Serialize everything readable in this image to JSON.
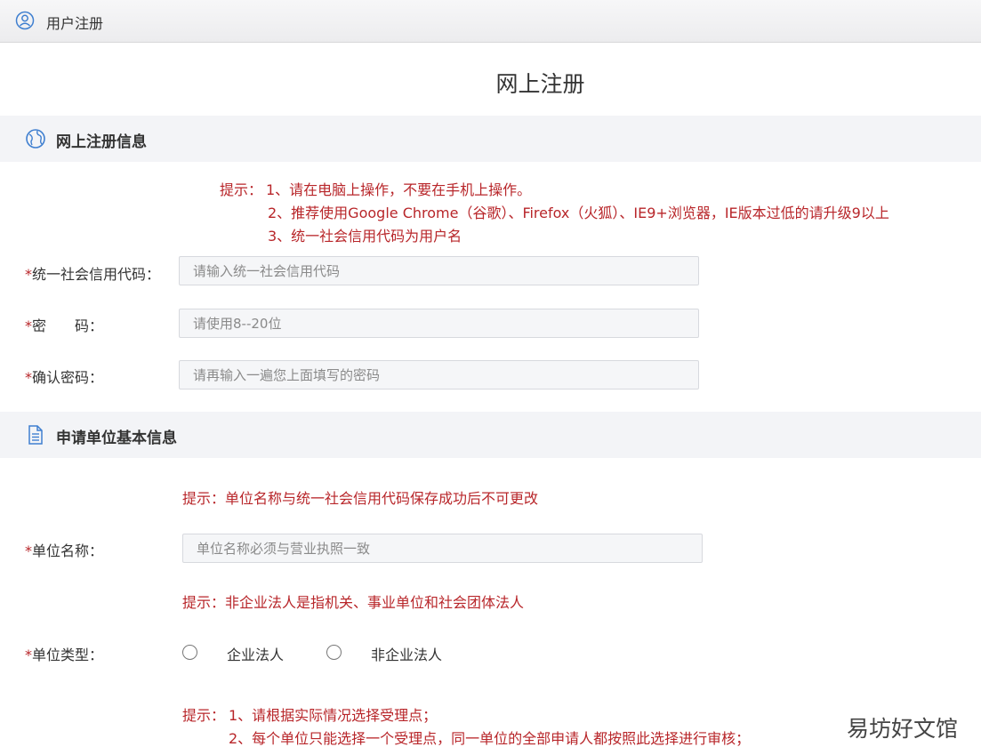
{
  "header": {
    "title": "用户注册",
    "icon": "user-circle-icon"
  },
  "page": {
    "title": "网上注册"
  },
  "section1": {
    "title": "网上注册信息",
    "icon": "globe-icon",
    "hint_prefix": "提示：",
    "hint_lines": [
      "1、请在电脑上操作，不要在手机上操作。",
      "2、推荐使用Google Chrome（谷歌）、Firefox（火狐）、IE9+浏览器，IE版本过低的请升级9以上",
      "3、统一社会信用代码为用户名"
    ],
    "fields": [
      {
        "required": "*",
        "label": "统一社会信用代码：",
        "placeholder": "请输入统一社会信用代码"
      },
      {
        "required": "*",
        "label": "密　　码：",
        "placeholder": "请使用8--20位"
      },
      {
        "required": "*",
        "label": "确认密码：",
        "placeholder": "请再输入一遍您上面填写的密码"
      }
    ]
  },
  "section2": {
    "title": "申请单位基本信息",
    "icon": "document-icon",
    "hint_name": "提示：单位名称与统一社会信用代码保存成功后不可更改",
    "name_field": {
      "required": "*",
      "label": "单位名称：",
      "placeholder": "单位名称必须与营业执照一致"
    },
    "hint_type": "提示：非企业法人是指机关、事业单位和社会团体法人",
    "type_field": {
      "required": "*",
      "label": "单位类型：",
      "options": [
        "企业法人",
        "非企业法人"
      ]
    },
    "hint_office_prefix": "提示：",
    "hint_office_lines": [
      "1、请根据实际情况选择受理点；",
      "2、每个单位只能选择一个受理点，同一单位的全部申请人都按照此选择进行审核；"
    ]
  },
  "watermark": "易坊好文馆",
  "colors": {
    "hint": "#b8262a",
    "section_bg": "#f3f4f7",
    "input_bg": "#f5f6f8"
  }
}
